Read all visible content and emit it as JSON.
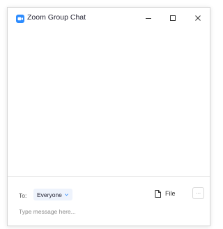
{
  "window": {
    "title": "Zoom Group Chat",
    "app_icon": "zoom-logo-icon",
    "accent_color": "#2D8CFF",
    "controls": {
      "minimize": "minimize-icon",
      "maximize": "maximize-icon",
      "close": "close-icon"
    }
  },
  "composer": {
    "to_label": "To:",
    "recipient": "Everyone",
    "recipient_icon": "chevron-down-icon",
    "file_label": "File",
    "file_icon": "file-icon",
    "more_icon": "more-icon",
    "more_label": "···",
    "message_placeholder": "Type message here..."
  }
}
